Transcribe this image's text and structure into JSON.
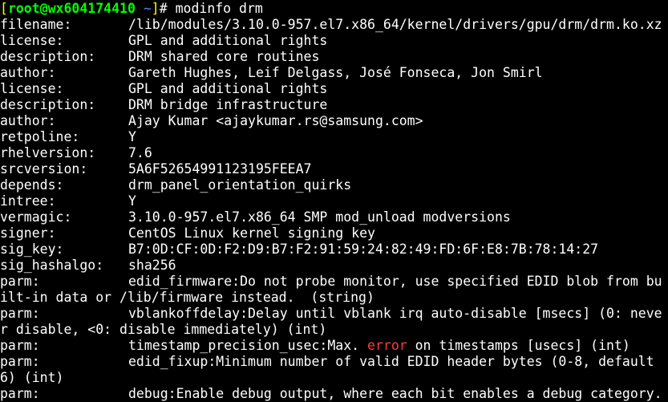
{
  "prompt": {
    "open": "[",
    "user_host": "root@wx604174410",
    "cwd": " ~",
    "close": "]",
    "symbol": "# ",
    "command": "modinfo drm"
  },
  "fields": [
    {
      "key": "filename:",
      "value": "/lib/modules/3.10.0-957.el7.x86_64/kernel/drivers/gpu/drm/drm.ko.xz"
    },
    {
      "key": "license:",
      "value": "GPL and additional rights"
    },
    {
      "key": "description:",
      "value": "DRM shared core routines"
    },
    {
      "key": "author:",
      "value": "Gareth Hughes, Leif Delgass, José Fonseca, Jon Smirl"
    },
    {
      "key": "license:",
      "value": "GPL and additional rights"
    },
    {
      "key": "description:",
      "value": "DRM bridge infrastructure"
    },
    {
      "key": "author:",
      "value": "Ajay Kumar <ajaykumar.rs@samsung.com>"
    },
    {
      "key": "retpoline:",
      "value": "Y"
    },
    {
      "key": "rhelversion:",
      "value": "7.6"
    },
    {
      "key": "srcversion:",
      "value": "5A6F52654991123195FEEA7"
    },
    {
      "key": "depends:",
      "value": "drm_panel_orientation_quirks"
    },
    {
      "key": "intree:",
      "value": "Y"
    },
    {
      "key": "vermagic:",
      "value": "3.10.0-957.el7.x86_64 SMP mod_unload modversions"
    },
    {
      "key": "signer:",
      "value": "CentOS Linux kernel signing key"
    },
    {
      "key": "sig_key:",
      "value": "B7:0D:CF:0D:F2:D9:B7:F2:91:59:24:82:49:FD:6F:E8:7B:78:14:27"
    },
    {
      "key": "sig_hashalgo:",
      "value": "sha256"
    }
  ],
  "parms": [
    {
      "key": "parm:",
      "line1": "edid_firmware:Do not probe monitor, use specified EDID blob from bu",
      "line2": "ilt-in data or /lib/firmware instead.  (string)"
    },
    {
      "key": "parm:",
      "line1": "vblankoffdelay:Delay until vblank irq auto-disable [msecs] (0: neve",
      "line2": "r disable, <0: disable immediately) (int)"
    },
    {
      "key": "parm:",
      "pre": "timestamp_precision_usec:Max. ",
      "highlight": "error",
      "post": " on timestamps [usecs] (int)"
    },
    {
      "key": "parm:",
      "line1": "edid_fixup:Minimum number of valid EDID header bytes (0-8, default",
      "line2": "6) (int)"
    },
    {
      "key": "parm:",
      "line1": "debug:Enable debug output, where each bit enables a debug category."
    }
  ],
  "colors": {
    "background": "#000000",
    "text": "#ffffff",
    "prompt_bracket": "#ffff00",
    "prompt_user_host": "#00ff00",
    "prompt_cwd": "#3d8bff",
    "error_highlight": "#ff3b3b"
  }
}
